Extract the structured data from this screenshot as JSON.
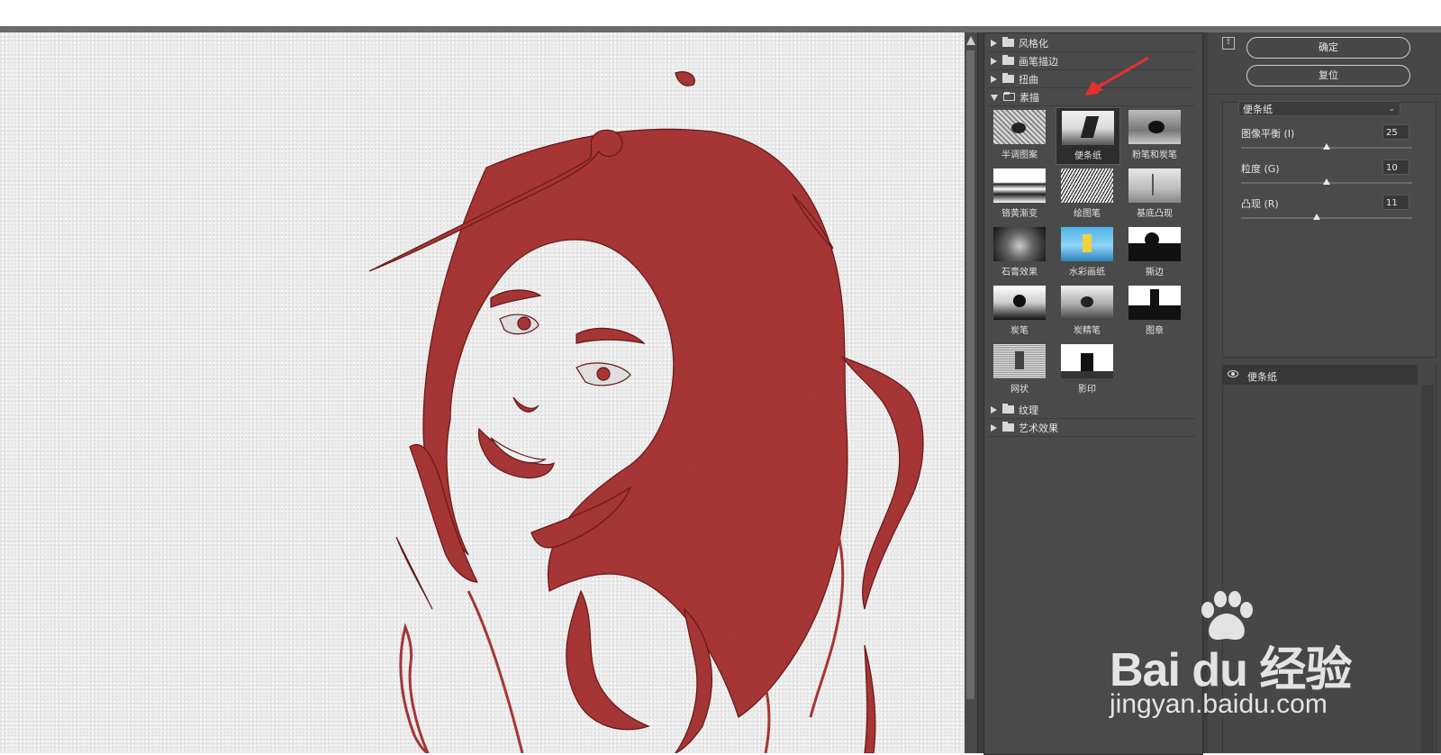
{
  "canvas": {
    "alt": "红色素描效果人像"
  },
  "filter_gallery": {
    "categories_top": [
      {
        "label": "风格化"
      },
      {
        "label": "画笔描边"
      },
      {
        "label": "扭曲"
      },
      {
        "label": "素描"
      }
    ],
    "thumbnails": [
      {
        "label": "半调图案"
      },
      {
        "label": "便条纸"
      },
      {
        "label": "粉笔和炭笔"
      },
      {
        "label": "铬黄渐变"
      },
      {
        "label": "绘图笔"
      },
      {
        "label": "基底凸现"
      },
      {
        "label": "石膏效果"
      },
      {
        "label": "水彩画纸"
      },
      {
        "label": "撕边"
      },
      {
        "label": "炭笔"
      },
      {
        "label": "炭精笔"
      },
      {
        "label": "图章"
      },
      {
        "label": "网状"
      },
      {
        "label": "影印"
      }
    ],
    "selected_filter": "便条纸",
    "categories_bottom": [
      {
        "label": "纹理"
      },
      {
        "label": "艺术效果"
      }
    ]
  },
  "settings": {
    "ok_label": "确定",
    "reset_label": "复位",
    "filter_select": "便条纸",
    "params": [
      {
        "label": "图像平衡 (I)",
        "value": "25",
        "fraction": 0.5
      },
      {
        "label": "粒度 (G)",
        "value": "10",
        "fraction": 0.5
      },
      {
        "label": "凸现 (R)",
        "value": "11",
        "fraction": 0.44
      }
    ]
  },
  "layers": [
    {
      "name": "便条纸"
    }
  ],
  "watermark": {
    "brand": "Bai du 经验",
    "url": "jingyan.baidu.com"
  },
  "colors": {
    "accent_red": "#b03a3a",
    "arrow_red": "#e53030"
  }
}
